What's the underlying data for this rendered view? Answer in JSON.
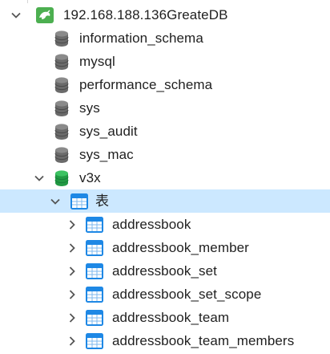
{
  "tree": {
    "connection": {
      "label": "192.168.188.136GreateDB",
      "icon": "server-connection-icon",
      "expanded": true,
      "color": "#4caf50"
    },
    "databases": [
      {
        "label": "information_schema",
        "icon": "database-icon",
        "color": "#6b6b6b"
      },
      {
        "label": "mysql",
        "icon": "database-icon",
        "color": "#6b6b6b"
      },
      {
        "label": "performance_schema",
        "icon": "database-icon",
        "color": "#6b6b6b"
      },
      {
        "label": "sys",
        "icon": "database-icon",
        "color": "#6b6b6b"
      },
      {
        "label": "sys_audit",
        "icon": "database-icon",
        "color": "#6b6b6b"
      },
      {
        "label": "sys_mac",
        "icon": "database-icon",
        "color": "#6b6b6b"
      },
      {
        "label": "v3x",
        "icon": "database-icon",
        "expanded": true,
        "color": "#29a84a"
      }
    ],
    "tables_folder": {
      "label": "表",
      "icon": "table-icon",
      "expanded": true,
      "selected": true,
      "selection_color": "#cce8ff"
    },
    "tables": [
      {
        "label": "addressbook",
        "icon": "table-icon"
      },
      {
        "label": "addressbook_member",
        "icon": "table-icon"
      },
      {
        "label": "addressbook_set",
        "icon": "table-icon"
      },
      {
        "label": "addressbook_set_scope",
        "icon": "table-icon"
      },
      {
        "label": "addressbook_team",
        "icon": "table-icon"
      },
      {
        "label": "addressbook_team_members",
        "icon": "table-icon"
      }
    ],
    "table_icon_color": "#1e88e5"
  }
}
